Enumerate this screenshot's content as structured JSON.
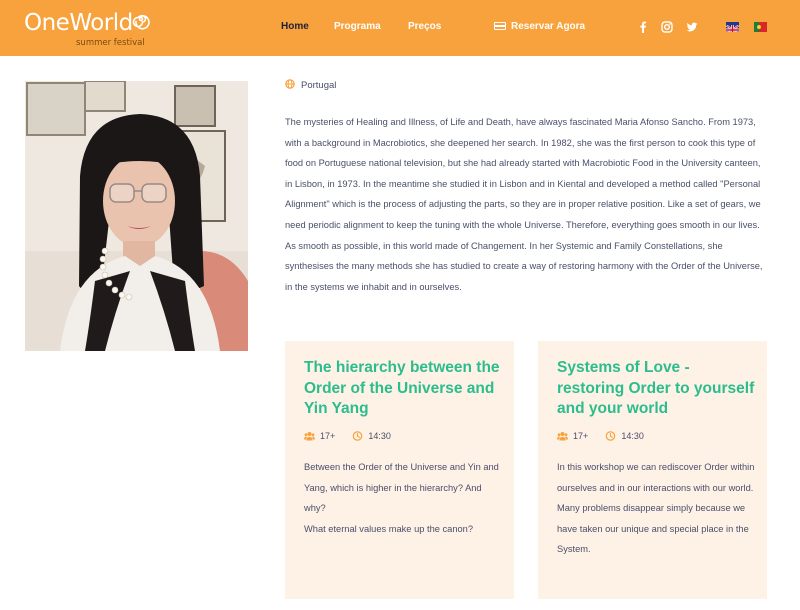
{
  "brand": {
    "name": "OneWorld",
    "tagline": "summer festival"
  },
  "nav": {
    "items": [
      {
        "label": "Home",
        "active": true
      },
      {
        "label": "Programa",
        "active": false
      },
      {
        "label": "Preços",
        "active": false
      }
    ],
    "reserve_label": "Reservar Agora"
  },
  "social": [
    "facebook-icon",
    "instagram-icon",
    "twitter-icon"
  ],
  "languages": [
    "en",
    "pt"
  ],
  "colors": {
    "header": "#f7a23c",
    "accent_green": "#2cbd8e",
    "card_bg": "#fef1e6",
    "icon_orange": "#f7a23c"
  },
  "speaker": {
    "country": "Portugal",
    "bio": "The mysteries of Healing and Illness, of Life and Death, have always fascinated Maria Afonso Sancho. From 1973, with a background in Macrobiotics, she deepened her search. In 1982, she was the first person to cook this type of food on Portuguese national television, but she had already started with Macrobiotic Food in the University canteen, in Lisbon, in 1973. In the meantime she studied it in Lisbon and in Kiental and developed a method called \"Personal Alignment\" which is the process of adjusting the parts, so they are in proper relative position. Like a set of gears, we need periodic alignment to keep the tuning with the whole Universe. Therefore, everything goes smooth in our lives. As smooth as possible, in this world made of Changement. In her Systemic and Family Constellations, she synthesises the many methods she has studied to create a way of restoring harmony with the Order of the Universe, in the systems we inhabit and in ourselves."
  },
  "workshops": [
    {
      "title": "The hierarchy between the Order of the Universe and Yin Yang",
      "age": "17+",
      "time": "14:30",
      "description": [
        "Between the Order of the Universe and Yin and Yang, which is higher in the hierarchy? And why?",
        "What eternal values make up the canon?"
      ]
    },
    {
      "title": "Systems of Love - restoring Order to yourself and your world",
      "age": "17+",
      "time": "14:30",
      "description": [
        "In this workshop we can rediscover Order within ourselves and in our interactions with our world.",
        "Many problems disappear simply because we have taken our unique and special place in the System."
      ]
    }
  ]
}
